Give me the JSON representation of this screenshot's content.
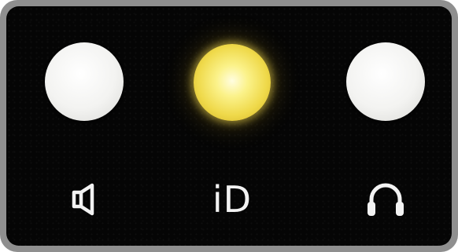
{
  "panel": {
    "controls": [
      {
        "id": "speaker",
        "icon": "speaker-icon",
        "state": "off"
      },
      {
        "id": "identify",
        "label": "iD",
        "state": "on",
        "light_color": "#f5e35a"
      },
      {
        "id": "headphones",
        "icon": "headphones-icon",
        "state": "off"
      }
    ],
    "colors": {
      "panel": "#050505",
      "bezel": "#8f8f8f",
      "button": "#f3f3f1",
      "glyph": "#f2f2f2"
    }
  }
}
